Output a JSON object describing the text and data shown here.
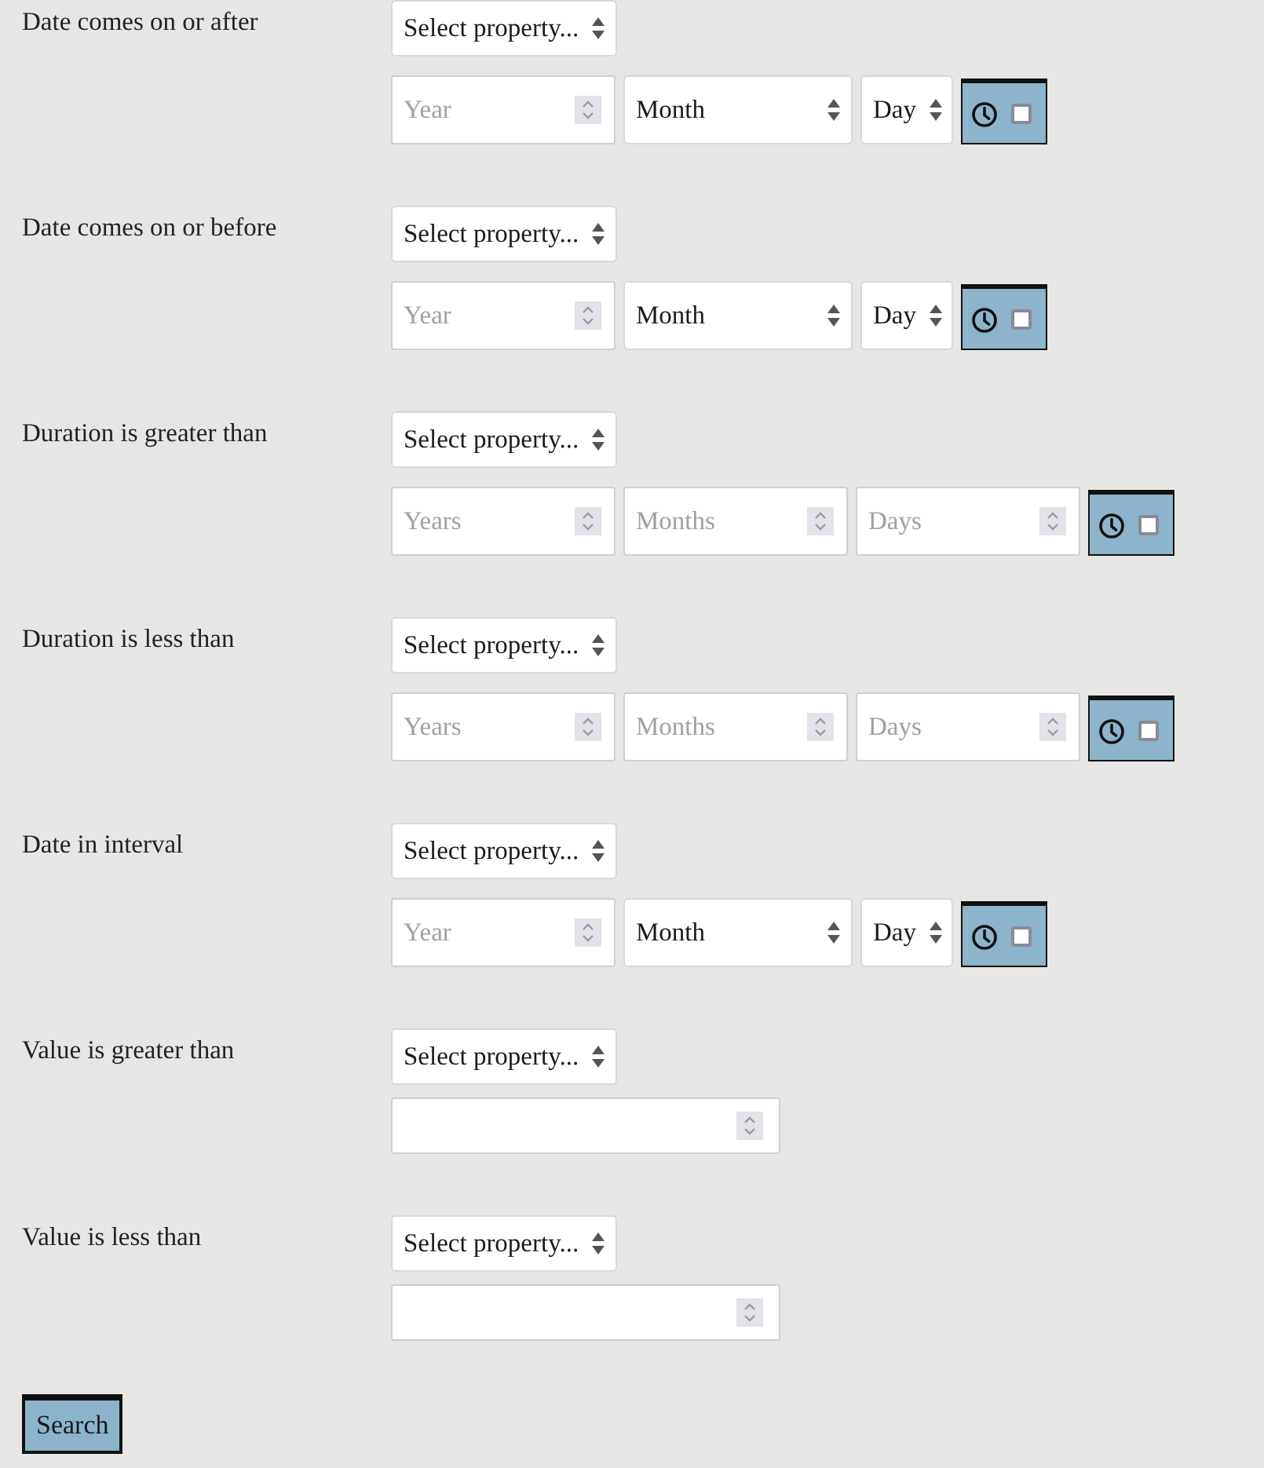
{
  "filters": [
    {
      "kind": "date",
      "label": "Date comes on or after",
      "property_select": {
        "value": "Select property..."
      },
      "inputs": [
        {
          "kind": "number",
          "placeholder": "Year"
        },
        {
          "kind": "select",
          "value": "Month"
        },
        {
          "kind": "select",
          "value": "Day"
        }
      ],
      "time_toggle": {
        "checked": false
      }
    },
    {
      "kind": "date",
      "label": "Date comes on or before",
      "property_select": {
        "value": "Select property..."
      },
      "inputs": [
        {
          "kind": "number",
          "placeholder": "Year"
        },
        {
          "kind": "select",
          "value": "Month"
        },
        {
          "kind": "select",
          "value": "Day"
        }
      ],
      "time_toggle": {
        "checked": false
      }
    },
    {
      "kind": "duration",
      "label": "Duration is greater than",
      "property_select": {
        "value": "Select property..."
      },
      "inputs": [
        {
          "kind": "number",
          "placeholder": "Years"
        },
        {
          "kind": "number",
          "placeholder": "Months"
        },
        {
          "kind": "number",
          "placeholder": "Days"
        }
      ],
      "time_toggle": {
        "checked": false
      }
    },
    {
      "kind": "duration",
      "label": "Duration is less than",
      "property_select": {
        "value": "Select property..."
      },
      "inputs": [
        {
          "kind": "number",
          "placeholder": "Years"
        },
        {
          "kind": "number",
          "placeholder": "Months"
        },
        {
          "kind": "number",
          "placeholder": "Days"
        }
      ],
      "time_toggle": {
        "checked": false
      }
    },
    {
      "kind": "date",
      "label": "Date in interval",
      "property_select": {
        "value": "Select property..."
      },
      "inputs": [
        {
          "kind": "number",
          "placeholder": "Year"
        },
        {
          "kind": "select",
          "value": "Month"
        },
        {
          "kind": "select",
          "value": "Day"
        }
      ],
      "time_toggle": {
        "checked": false
      }
    },
    {
      "kind": "value",
      "label": "Value is greater than",
      "property_select": {
        "value": "Select property..."
      },
      "inputs": [
        {
          "kind": "number"
        }
      ]
    },
    {
      "kind": "value",
      "label": "Value is less than",
      "property_select": {
        "value": "Select property..."
      },
      "inputs": [
        {
          "kind": "number"
        }
      ]
    }
  ],
  "search_button": {
    "label": "Search"
  }
}
